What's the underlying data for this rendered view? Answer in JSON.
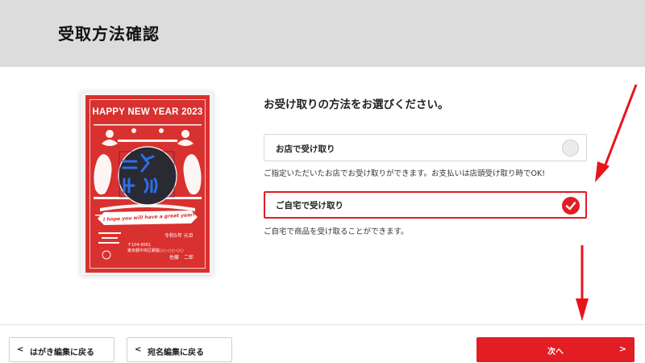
{
  "header": {
    "title": "受取方法確認"
  },
  "card": {
    "title": "HAPPY NEW YEAR 2023",
    "banner": "I hope you will have a great year!",
    "era": "令和5年 元旦",
    "postal": "〒104-0061",
    "address": "東京都中央区銀座○○-○○-○○",
    "name": "佐藤　二郎"
  },
  "main": {
    "question": "お受け取りの方法をお選びください。",
    "options": [
      {
        "label": "お店で受け取り",
        "description": "ご指定いただいたお店でお受け取りができます。お支払いは店頭受け取り時でOK!",
        "selected": false
      },
      {
        "label": "ご自宅で受け取り",
        "description": "ご自宅で商品を受け取ることができます。",
        "selected": true
      }
    ]
  },
  "footer": {
    "back_postcard": "はがき編集に戻る",
    "back_address": "宛名編集に戻る",
    "next": "次へ"
  },
  "colors": {
    "accent": "#e21d24",
    "card_red": "#d9312f",
    "header_bg": "#dcdcdc"
  }
}
